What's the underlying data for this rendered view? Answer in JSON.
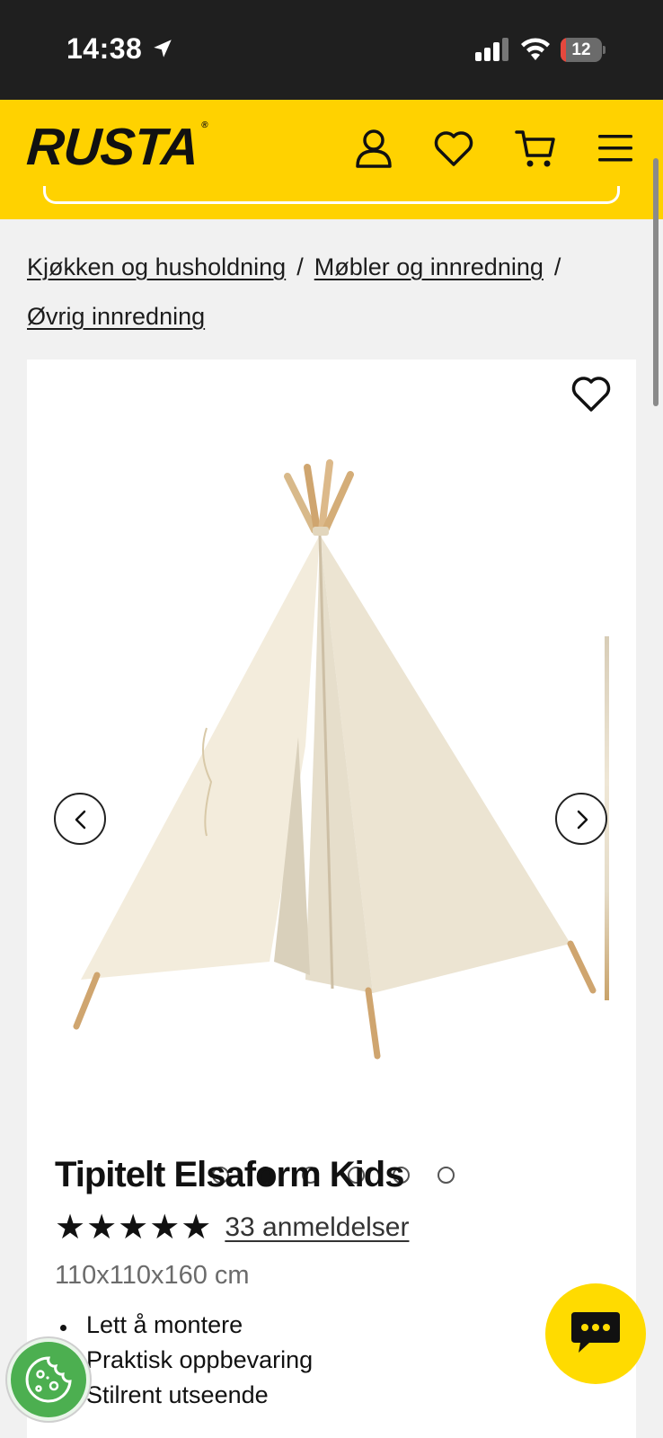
{
  "status_bar": {
    "time": "14:38",
    "battery": "12",
    "battery_level": 0.12,
    "icons": [
      "location-arrow-icon",
      "signal-icon",
      "wifi-icon",
      "battery-icon"
    ]
  },
  "header": {
    "logo": "RUSTA",
    "logo_mark": "®",
    "icons": [
      "account-icon",
      "heart-icon",
      "cart-icon",
      "menu-icon"
    ],
    "colors": {
      "brand_yellow": "#ffd200",
      "dark": "#1f1f1f"
    }
  },
  "breadcrumb": {
    "items": [
      "Kjøkken og husholdning",
      "Møbler og innredning",
      "Øvrig innredning"
    ],
    "separator": "/"
  },
  "product": {
    "title": "Tipitelt Elsaform Kids",
    "stars": "★★★★★",
    "rating": 5,
    "reviews_label": "33 anmeldelser",
    "dimensions": "110x110x160 cm",
    "features": [
      "Lett å montere",
      "Praktisk oppbevaring",
      "Stilrent utseende"
    ],
    "gallery": {
      "image_count": 6,
      "active_index": 1,
      "icons": [
        "chevron-left-icon",
        "chevron-right-icon",
        "heart-icon"
      ]
    }
  },
  "floating": {
    "icons": [
      "chat-icon",
      "cookie-icon"
    ],
    "colors": {
      "chat": "#ffdb00",
      "cookie": "#4caf50"
    }
  }
}
